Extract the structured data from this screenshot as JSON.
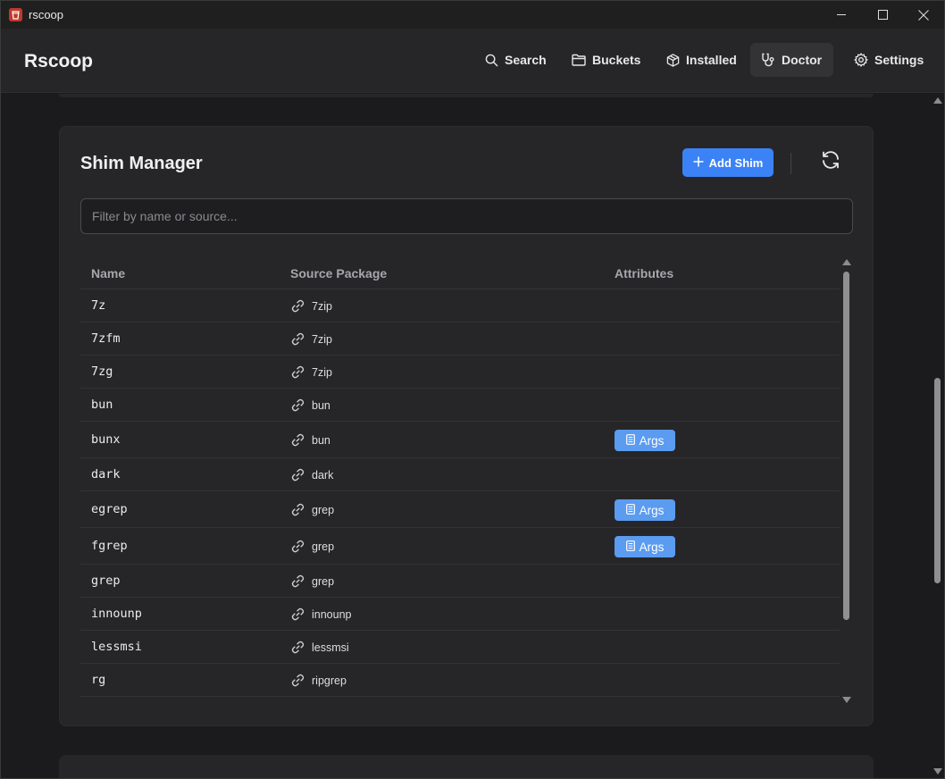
{
  "window": {
    "title": "rscoop"
  },
  "header": {
    "brand": "Rscoop",
    "nav": [
      {
        "label": "Search",
        "icon": "search-icon",
        "active": false
      },
      {
        "label": "Buckets",
        "icon": "folder-icon",
        "active": false
      },
      {
        "label": "Installed",
        "icon": "package-icon",
        "active": false
      },
      {
        "label": "Doctor",
        "icon": "stethoscope-icon",
        "active": true
      },
      {
        "label": "Settings",
        "icon": "gear-icon",
        "active": false
      }
    ]
  },
  "shim_manager": {
    "title": "Shim Manager",
    "add_button": "Add Shim",
    "filter_placeholder": "Filter by name or source...",
    "columns": [
      "Name",
      "Source Package",
      "Attributes"
    ],
    "rows": [
      {
        "name": "7z",
        "source": "7zip",
        "args": false
      },
      {
        "name": "7zfm",
        "source": "7zip",
        "args": false
      },
      {
        "name": "7zg",
        "source": "7zip",
        "args": false
      },
      {
        "name": "bun",
        "source": "bun",
        "args": false
      },
      {
        "name": "bunx",
        "source": "bun",
        "args": true
      },
      {
        "name": "dark",
        "source": "dark",
        "args": false
      },
      {
        "name": "egrep",
        "source": "grep",
        "args": true
      },
      {
        "name": "fgrep",
        "source": "grep",
        "args": true
      },
      {
        "name": "grep",
        "source": "grep",
        "args": false
      },
      {
        "name": "innounp",
        "source": "innounp",
        "args": false
      },
      {
        "name": "lessmsi",
        "source": "lessmsi",
        "args": false
      },
      {
        "name": "rg",
        "source": "ripgrep",
        "args": false
      }
    ],
    "args_label": "Args"
  },
  "colors": {
    "accent": "#3b82f6",
    "args_badge": "#5b9bf0",
    "card": "#262628",
    "background": "#1b1b1d"
  }
}
